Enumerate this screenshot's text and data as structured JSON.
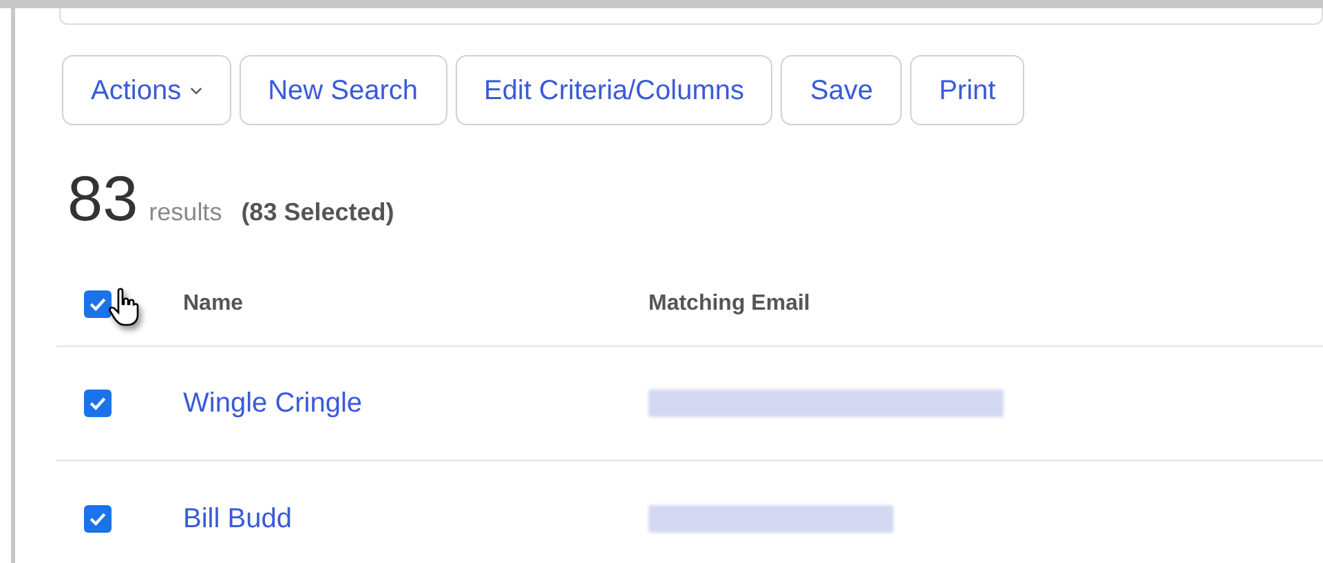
{
  "toolbar": [
    {
      "label": "Actions",
      "kind": "dropdown"
    },
    {
      "label": "New Search",
      "kind": "button"
    },
    {
      "label": "Edit Criteria/Columns",
      "kind": "button"
    },
    {
      "label": "Save",
      "kind": "button"
    },
    {
      "label": "Print",
      "kind": "button"
    }
  ],
  "summary": {
    "count": "83",
    "unit": "results",
    "selected": "(83 Selected)"
  },
  "table": {
    "select_all": {
      "checked": true
    },
    "columns": [
      "Name",
      "Matching Email"
    ],
    "rows": [
      {
        "checked": true,
        "name": "Wingle Cringle"
      },
      {
        "checked": true,
        "name": "Bill Budd"
      }
    ]
  }
}
